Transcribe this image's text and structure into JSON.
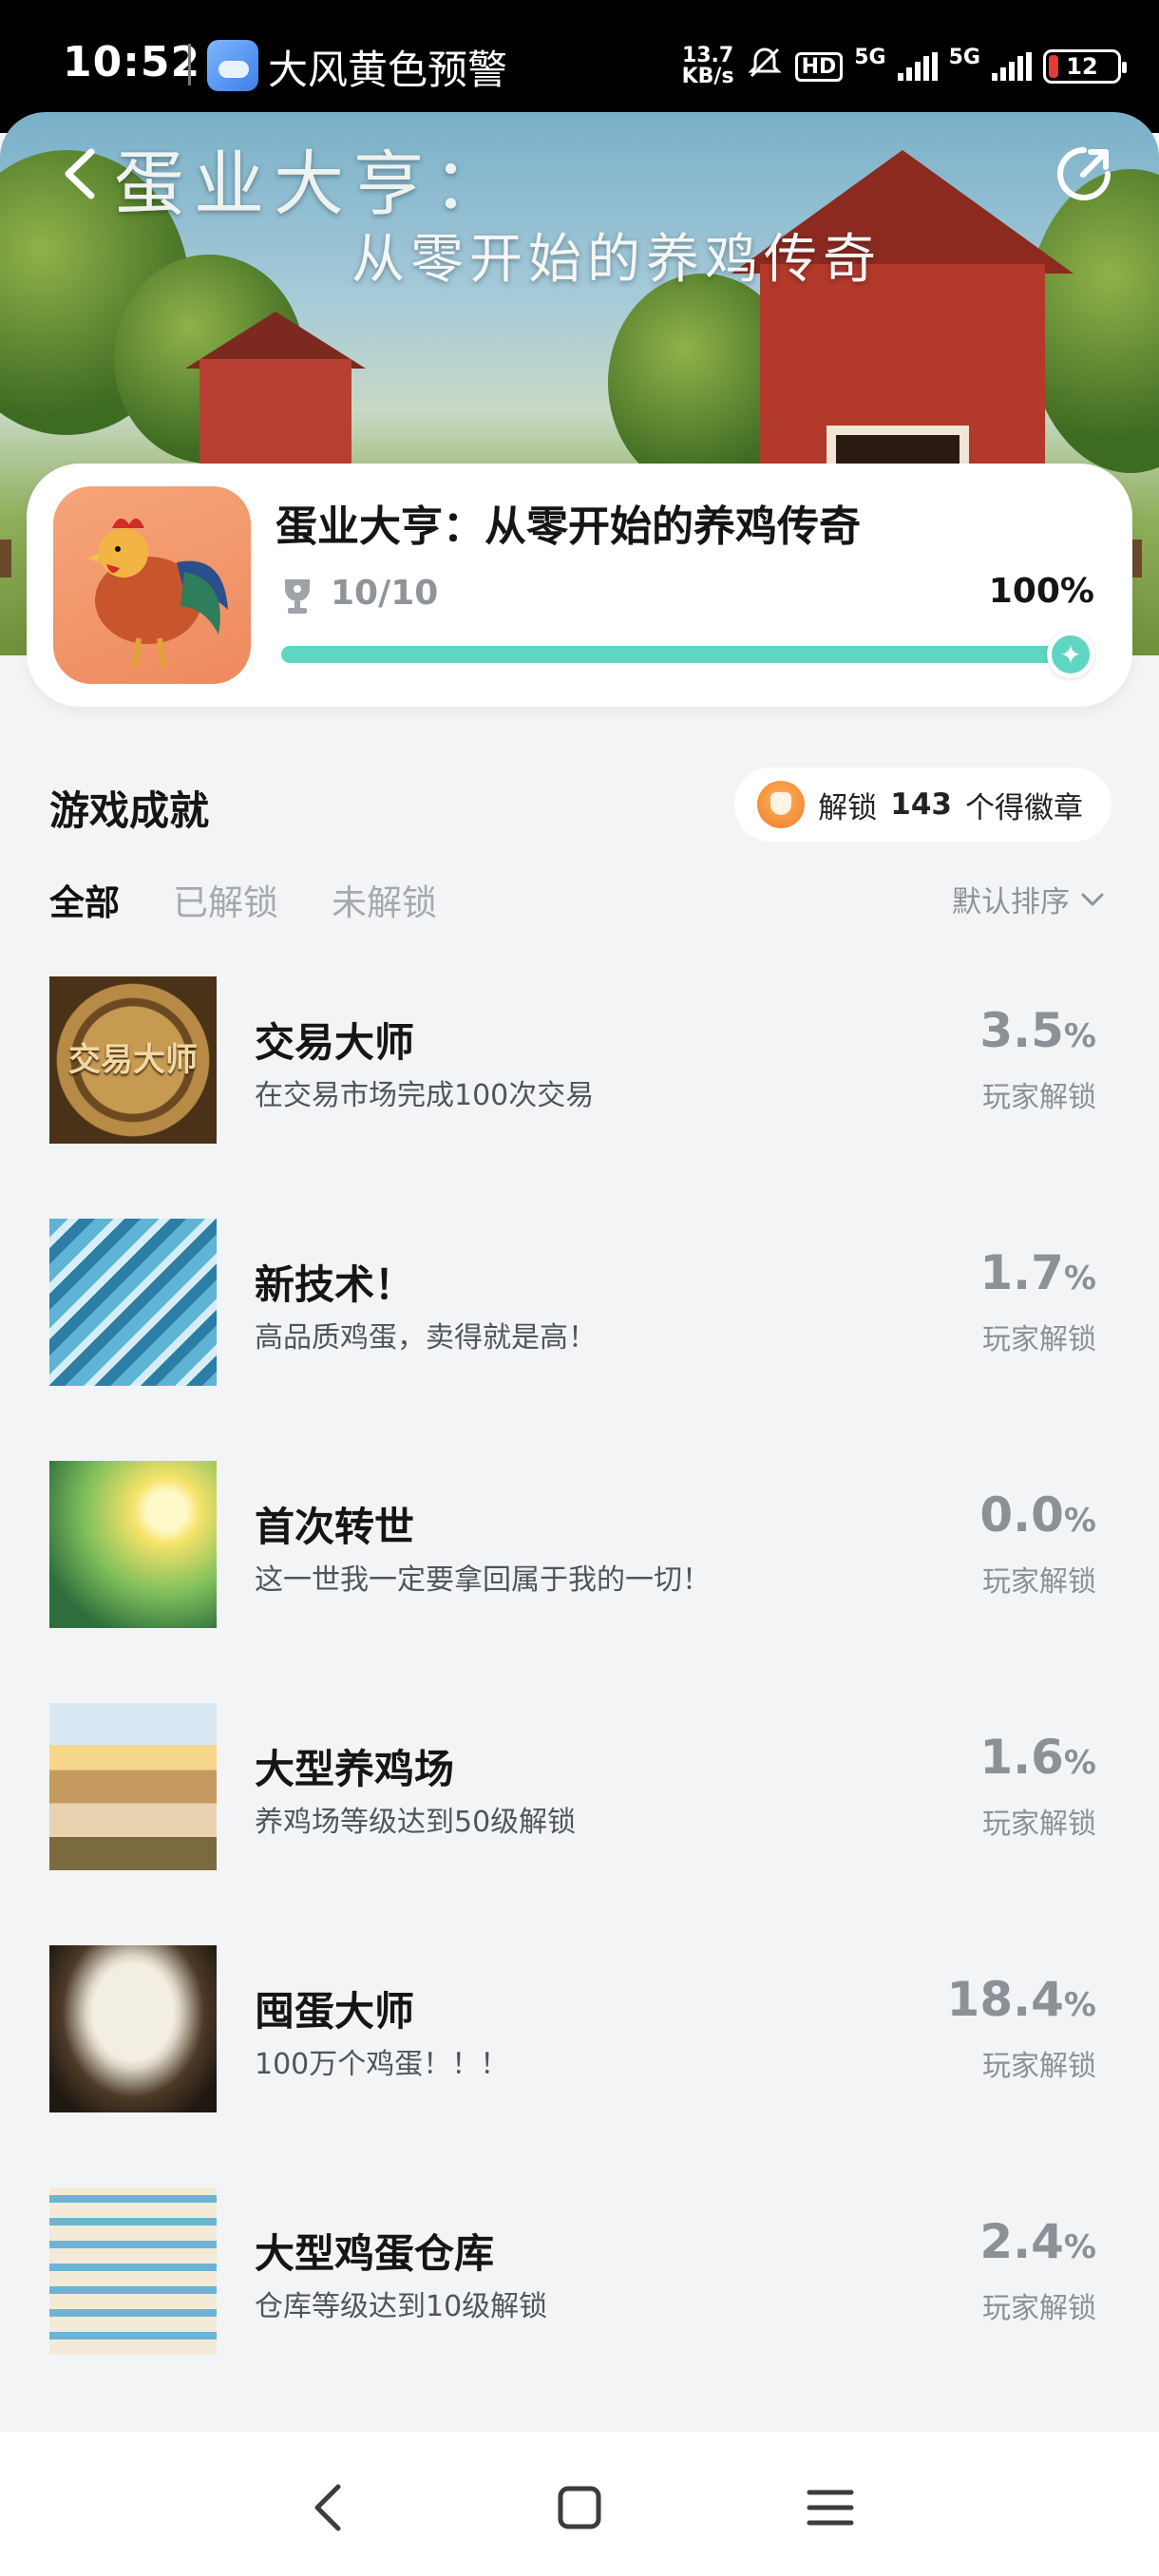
{
  "status_bar": {
    "time": "10:52",
    "notification": "大风黄色预警",
    "net_speed_value": "13.7",
    "net_speed_unit": "KB/s",
    "hd_label": "HD",
    "network_1": "5G",
    "network_2": "5G",
    "battery": "12"
  },
  "hero": {
    "title": "蛋业大亨：",
    "subtitle": "从零开始的养鸡传奇"
  },
  "game": {
    "name": "蛋业大亨：从零开始的养鸡传奇",
    "progress_text": "10/10",
    "percent_text": "100%",
    "progress_fraction": 1.0,
    "accent_color": "#5fd5c3"
  },
  "section": {
    "title": "游戏成就",
    "badge_prefix": "解锁",
    "badge_count": "143",
    "badge_suffix": "个得徽章"
  },
  "tabs": [
    {
      "label": "全部",
      "active": true
    },
    {
      "label": "已解锁",
      "active": false
    },
    {
      "label": "未解锁",
      "active": false
    }
  ],
  "sort_label": "默认排序",
  "achievements": [
    {
      "title": "交易大师",
      "desc": "在交易市场完成100次交易",
      "rate": "3.5",
      "pct": "%",
      "rate_label": "玩家解锁",
      "thumb_text": "交易大师"
    },
    {
      "title": "新技术！",
      "desc": "高品质鸡蛋，卖得就是高！",
      "rate": "1.7",
      "pct": "%",
      "rate_label": "玩家解锁"
    },
    {
      "title": "首次转世",
      "desc": "这一世我一定要拿回属于我的一切！",
      "rate": "0.0",
      "pct": "%",
      "rate_label": "玩家解锁"
    },
    {
      "title": "大型养鸡场",
      "desc": "养鸡场等级达到50级解锁",
      "rate": "1.6",
      "pct": "%",
      "rate_label": "玩家解锁"
    },
    {
      "title": "囤蛋大师",
      "desc": "100万个鸡蛋！！！",
      "rate": "18.4",
      "pct": "%",
      "rate_label": "玩家解锁"
    },
    {
      "title": "大型鸡蛋仓库",
      "desc": "仓库等级达到10级解锁",
      "rate": "2.4",
      "pct": "%",
      "rate_label": "玩家解锁"
    }
  ]
}
